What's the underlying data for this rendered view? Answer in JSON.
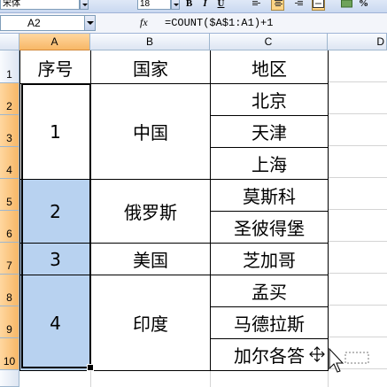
{
  "toolbar": {
    "font_name": "宋体",
    "font_size": "18",
    "bold_label": "B",
    "italic_label": "I",
    "underline_label": "U",
    "percent_label": "%"
  },
  "formula_bar": {
    "name_box": "A2",
    "fx_label": "fx",
    "formula": "=COUNT($A$1:A1)+1"
  },
  "columns": [
    "A",
    "B",
    "C",
    "D"
  ],
  "rows": [
    "1",
    "2",
    "3",
    "4",
    "5",
    "6",
    "7",
    "8",
    "9",
    "10"
  ],
  "headers": {
    "a": "序号",
    "b": "国家",
    "c": "地区"
  },
  "groups": [
    {
      "index": "1",
      "country": "中国",
      "regions": [
        "北京",
        "天津",
        "上海"
      ]
    },
    {
      "index": "2",
      "country": "俄罗斯",
      "regions": [
        "莫斯科",
        "圣彼得堡"
      ]
    },
    {
      "index": "3",
      "country": "美国",
      "regions": [
        "芝加哥"
      ]
    },
    {
      "index": "4",
      "country": "印度",
      "regions": [
        "孟买",
        "马德拉斯",
        "加尔各答"
      ]
    }
  ],
  "icons": {
    "name_box_drop": "chevron-down-icon",
    "fx": "function-icon",
    "move_cursor": "move-cursor-icon"
  },
  "colors": {
    "selection_fill": "#b8d2f0",
    "header_selected": "#f7b766"
  }
}
